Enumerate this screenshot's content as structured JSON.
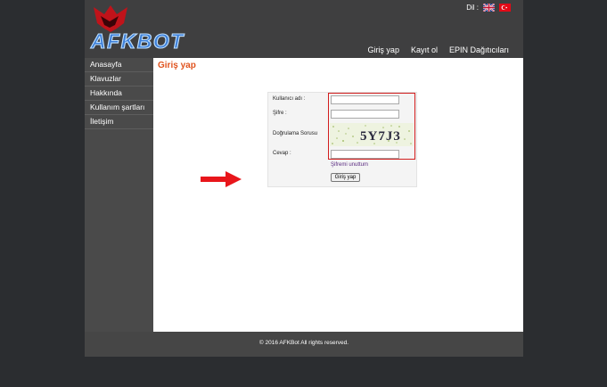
{
  "header": {
    "logo_text": "AFKBOT",
    "language_label": "Dil :",
    "flags": [
      "uk-flag-icon",
      "tr-flag-icon"
    ],
    "nav": [
      "Giriş yap",
      "Kayıt ol",
      "EPIN Dağıtıcıları"
    ]
  },
  "sidebar": {
    "items": [
      {
        "label": "Anasayfa"
      },
      {
        "label": "Klavuzlar"
      },
      {
        "label": "Hakkında"
      },
      {
        "label": "Kullanım şartları"
      },
      {
        "label": "İletişim"
      }
    ]
  },
  "main": {
    "title": "Giriş yap",
    "form": {
      "username_label": "Kullanıcı adı :",
      "username_value": "",
      "password_label": "Şifre :",
      "password_value": "",
      "captcha_label": "Doğrulama Sorusu",
      "captcha_text": "5Y7J3",
      "answer_label": "Cevap :",
      "answer_value": "",
      "forgot_link": "Şifremi unuttum",
      "submit_label": "Giriş yap"
    }
  },
  "footer": {
    "copyright": "© 2016 AFKBot All rights reserved."
  },
  "colors": {
    "title_accent": "#e0531e",
    "highlight_border": "#d21d1d",
    "annotation_arrow": "#e8161b"
  }
}
